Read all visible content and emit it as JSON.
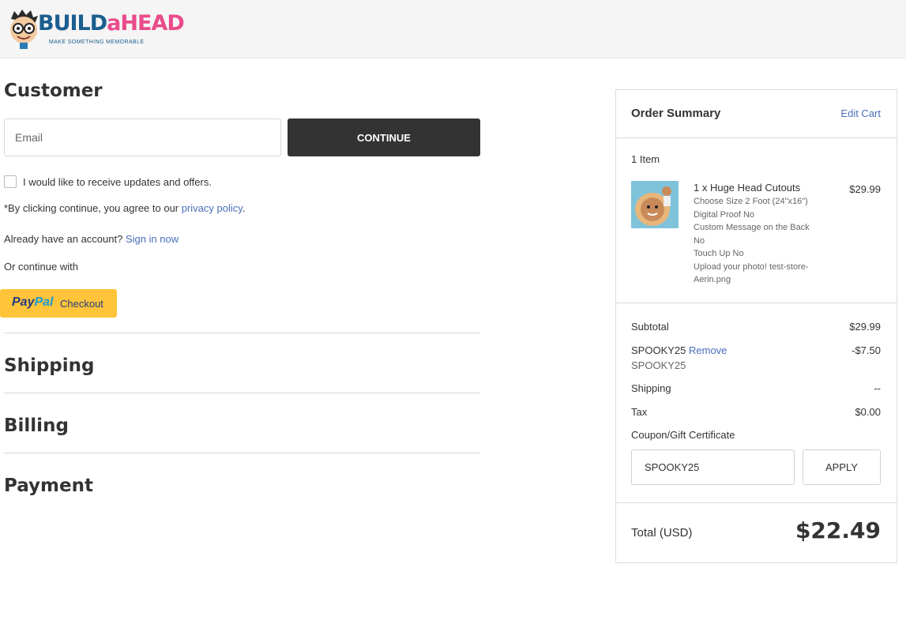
{
  "header": {
    "logo_text_part1": "BUILD",
    "logo_text_part2": "a",
    "logo_text_part3": "HEAD",
    "logo_tagline": "MAKE SOMETHING MEMORABLE"
  },
  "customer": {
    "title": "Customer",
    "email_placeholder": "Email",
    "email_value": "",
    "continue_label": "CONTINUE",
    "updates_label": "I would like to receive updates and offers.",
    "updates_checked": false,
    "agree_prefix": "*By clicking continue, you agree to our ",
    "privacy_link": "privacy policy",
    "agree_suffix": ".",
    "account_prefix": "Already have an account? ",
    "sign_in_link": "Sign in now",
    "continue_with": "Or continue with",
    "paypal_word1": "Pay",
    "paypal_word2": "Pal",
    "paypal_checkout": "Checkout"
  },
  "sections": {
    "shipping": "Shipping",
    "billing": "Billing",
    "payment": "Payment"
  },
  "summary": {
    "title": "Order Summary",
    "edit_cart": "Edit Cart",
    "item_count": "1 Item",
    "item": {
      "name": "1 x Huge Head Cutouts",
      "price": "$29.99",
      "options": [
        "Choose Size 2 Foot (24\"x16\")",
        "Digital Proof No",
        "Custom Message on the Back No",
        "Touch Up No",
        "Upload your photo! test-store-Aerin.png"
      ]
    },
    "subtotal_label": "Subtotal",
    "subtotal_value": "$29.99",
    "coupon_code": "SPOOKY25",
    "coupon_remove": "Remove",
    "coupon_value": "-$7.50",
    "coupon_code_sub": "SPOOKY25",
    "shipping_label": "Shipping",
    "shipping_value": "--",
    "tax_label": "Tax",
    "tax_value": "$0.00",
    "coupon_link": "Coupon/Gift Certificate",
    "coupon_input_value": "SPOOKY25",
    "apply_label": "APPLY",
    "total_label": "Total (USD)",
    "total_value": "$22.49"
  },
  "colors": {
    "link": "#4a6ebb",
    "button_dark": "#333333",
    "paypal_yellow": "#ffc439"
  }
}
